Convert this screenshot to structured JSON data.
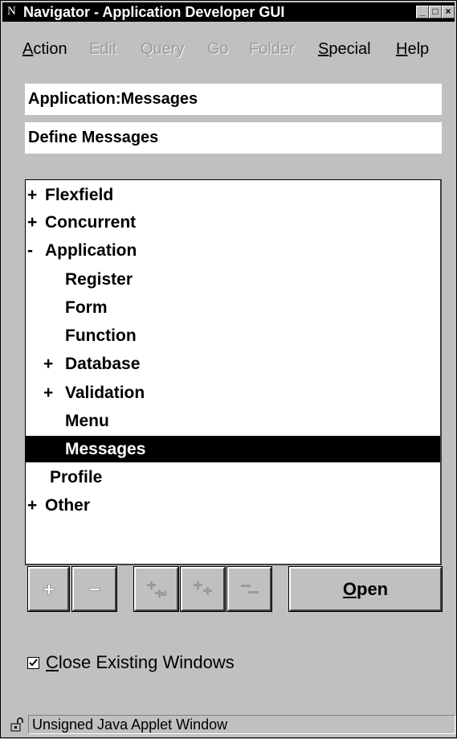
{
  "window": {
    "title": "Navigator - Application Developer GUI",
    "app_icon_glyph": "N",
    "controls": {
      "minimize": "_",
      "maximize": "□",
      "close": "×"
    }
  },
  "menu": [
    {
      "label": "Action",
      "accel": "A",
      "rest": "ction",
      "enabled": true
    },
    {
      "label": "Edit",
      "enabled": false
    },
    {
      "label": "Query",
      "enabled": false
    },
    {
      "label": "Go",
      "enabled": false
    },
    {
      "label": "Folder",
      "enabled": false
    },
    {
      "label": "Special",
      "accel": "S",
      "rest": "pecial",
      "enabled": true
    },
    {
      "label": "Help",
      "accel": "H",
      "rest": "elp",
      "enabled": true
    }
  ],
  "fields": {
    "path": "Application:Messages",
    "description": "Define Messages"
  },
  "tree": {
    "items": [
      {
        "prefix": "+",
        "label": "Flexfield",
        "level": 0,
        "selected": false
      },
      {
        "prefix": "+",
        "label": "Concurrent",
        "level": 0,
        "selected": false
      },
      {
        "prefix": "-",
        "label": "Application",
        "level": 0,
        "selected": false
      },
      {
        "prefix": "",
        "label": "Register",
        "level": 1,
        "selected": false
      },
      {
        "prefix": "",
        "label": "Form",
        "level": 1,
        "selected": false
      },
      {
        "prefix": "",
        "label": "Function",
        "level": 1,
        "selected": false
      },
      {
        "prefix": "+",
        "label": "Database",
        "level": 1,
        "selected": false
      },
      {
        "prefix": "+",
        "label": "Validation",
        "level": 1,
        "selected": false
      },
      {
        "prefix": "",
        "label": "Menu",
        "level": 1,
        "selected": false
      },
      {
        "prefix": "",
        "label": "Messages",
        "level": 1,
        "selected": true
      },
      {
        "prefix": "",
        "label": "Profile",
        "level": 0.5,
        "selected": false
      },
      {
        "prefix": "+",
        "label": "Other",
        "level": 0,
        "selected": false
      }
    ]
  },
  "toolbar": {
    "expand_icon": "expand-icon",
    "collapse_icon": "collapse-icon",
    "expand_branch_icon": "expand-branch-icon",
    "expand_all_icon": "expand-all-icon",
    "collapse_all_icon": "collapse-all-icon",
    "open_label_accel": "O",
    "open_label_rest": "pen"
  },
  "options": {
    "close_windows_checked": true,
    "close_windows_accel": "C",
    "close_windows_rest": "lose Existing Windows"
  },
  "status": {
    "text": "Unsigned Java Applet Window"
  },
  "colors": {
    "background": "#c0c0c0",
    "selection": "#000000",
    "field": "#ffffff",
    "disabled_text": "#9a9a9a"
  }
}
